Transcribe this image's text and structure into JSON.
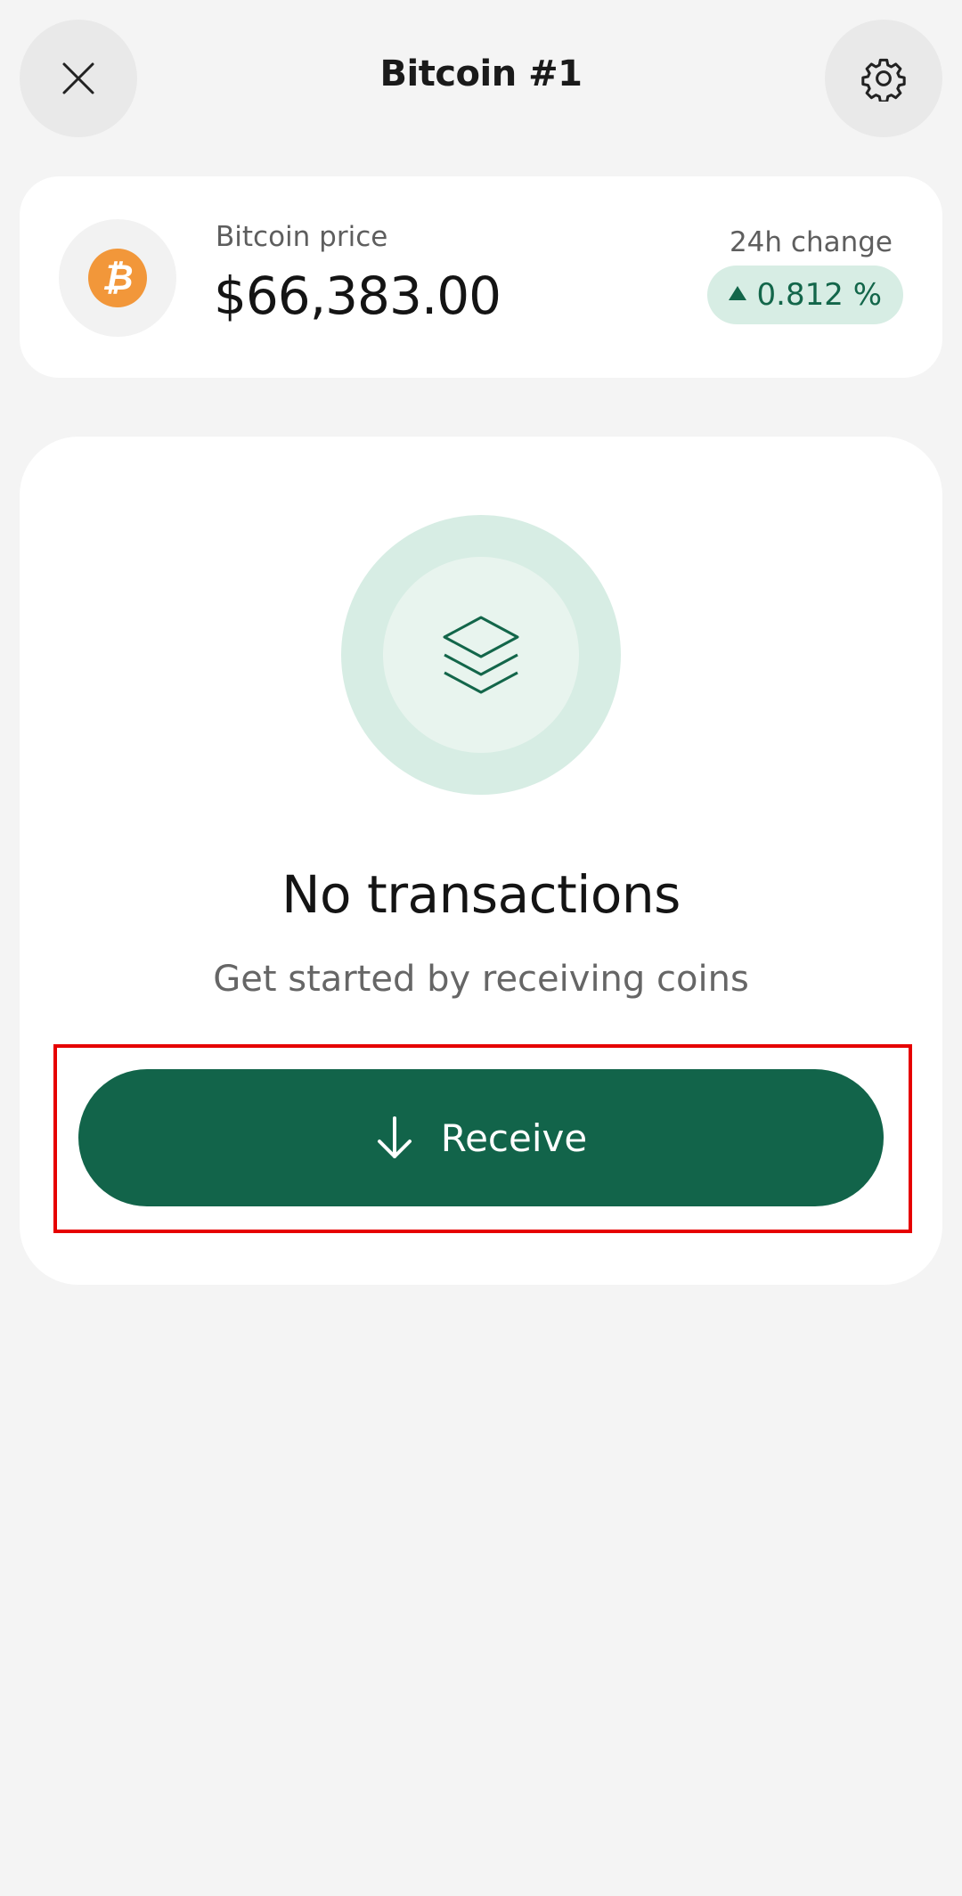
{
  "header": {
    "title": "Bitcoin #1",
    "close_icon": "close-icon",
    "settings_icon": "gear-icon"
  },
  "price_card": {
    "coin_icon": "bitcoin-icon",
    "coin_symbol": "₿",
    "price_label": "Bitcoin price",
    "price_value": "$66,383.00",
    "change_label": "24h change",
    "change_value": "0.812 %",
    "change_direction": "up"
  },
  "transactions": {
    "empty_icon": "layers-icon",
    "empty_title": "No transactions",
    "empty_subtitle": "Get started by receiving coins",
    "receive_label": "Receive",
    "receive_icon": "arrow-down-icon"
  },
  "colors": {
    "accent": "#12644a",
    "accent_light": "#d7ede4",
    "bitcoin": "#f2973a",
    "background": "#f4f4f4",
    "highlight": "#e60000"
  }
}
